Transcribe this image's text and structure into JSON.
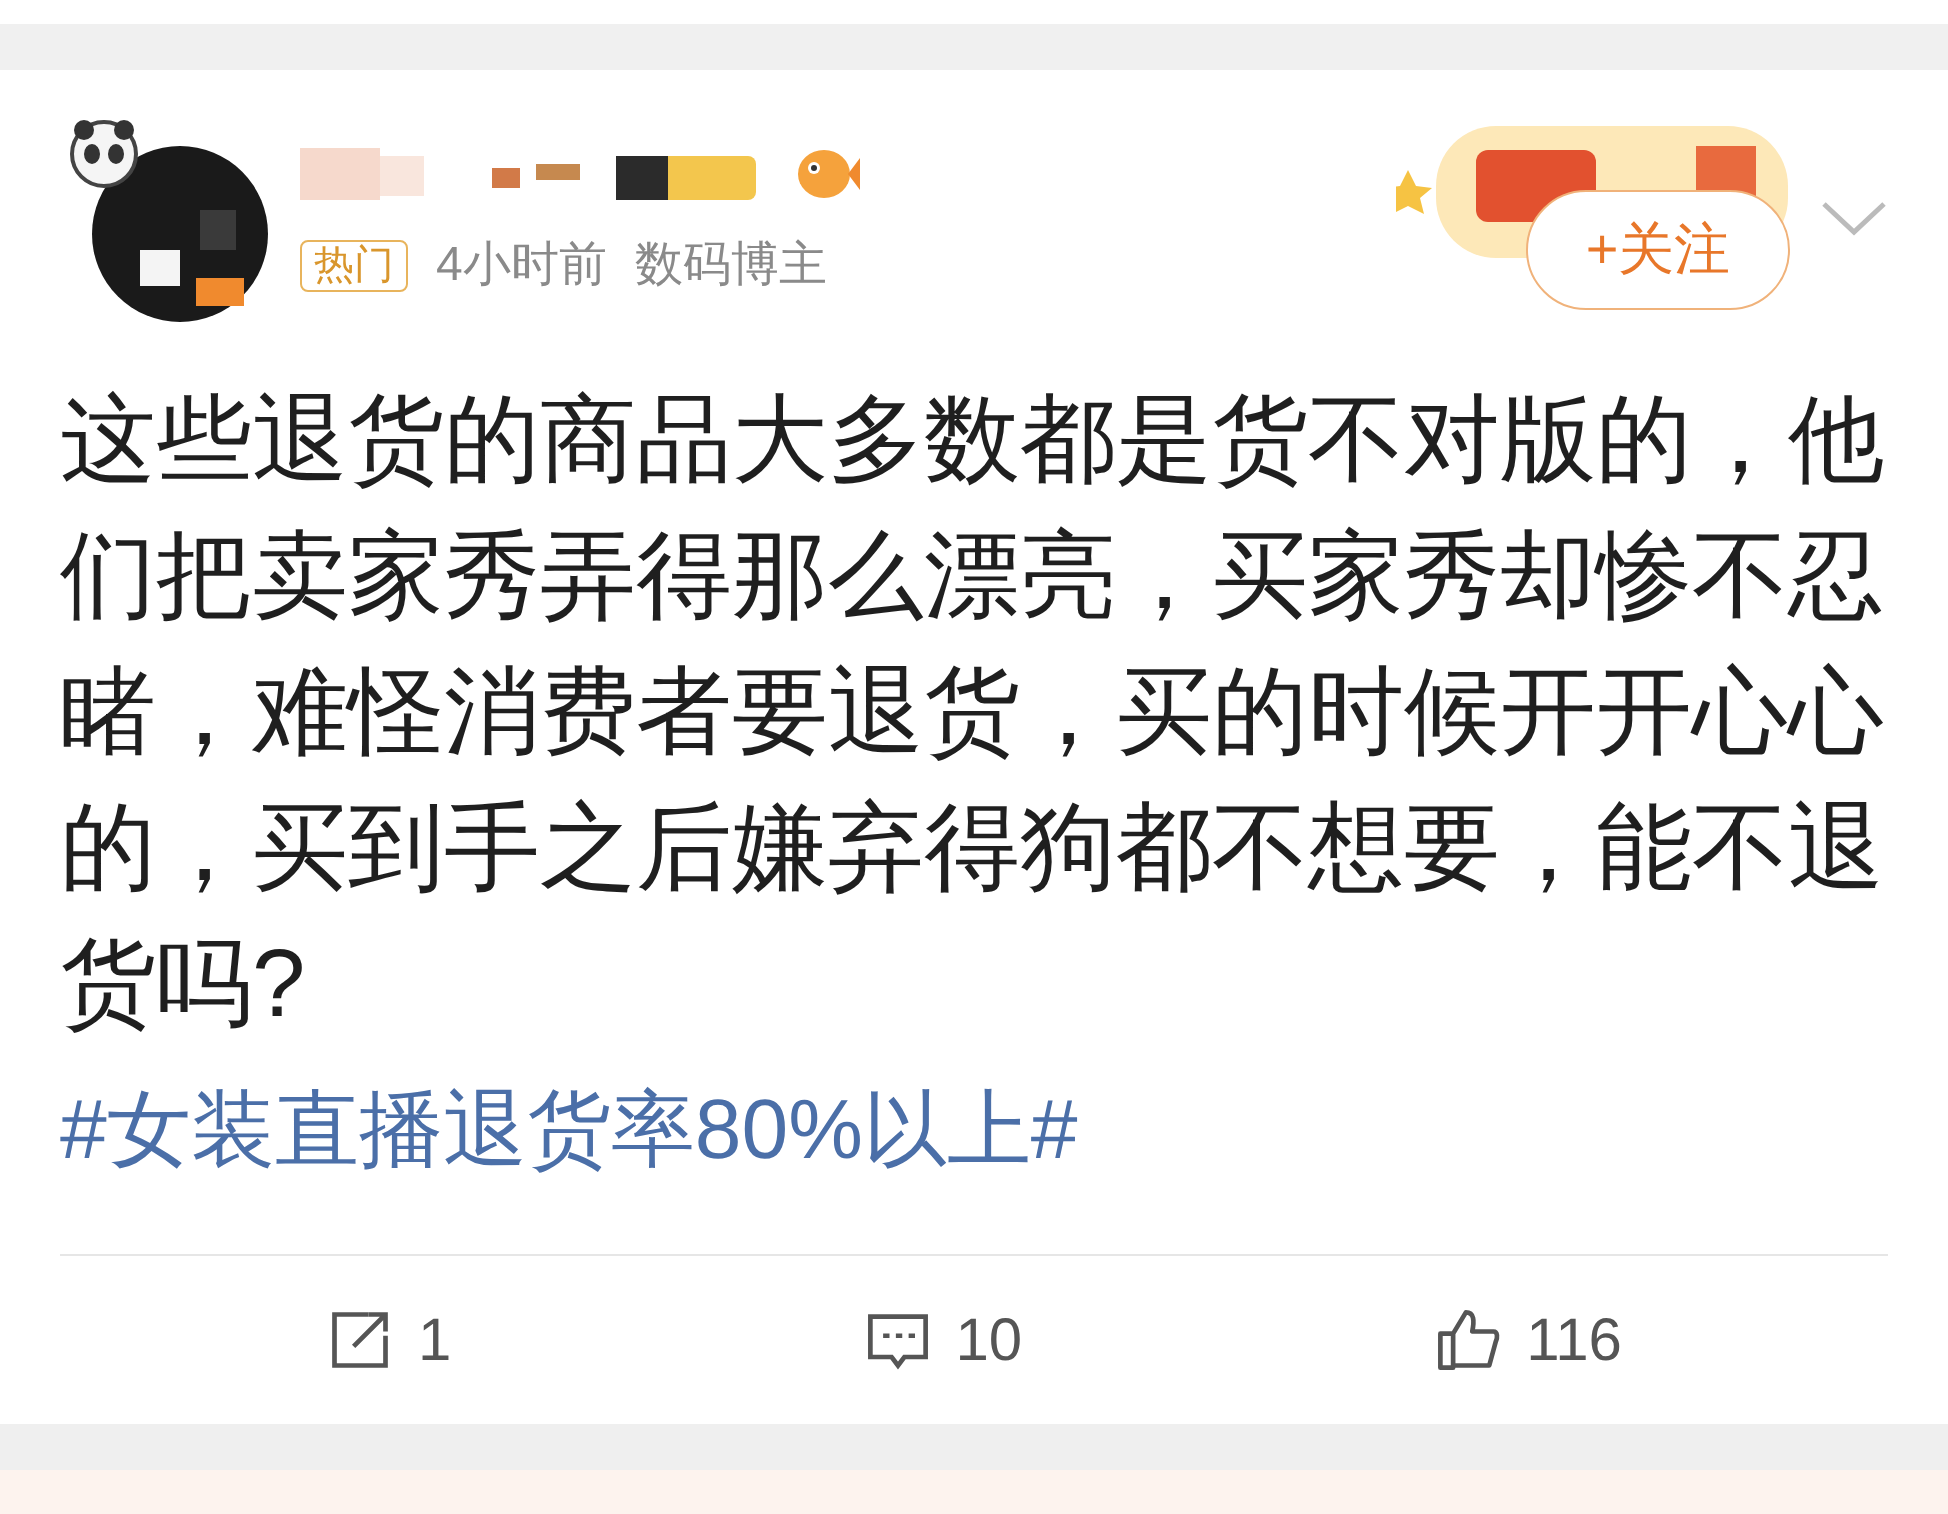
{
  "post": {
    "badge": "热门",
    "time": "4小时前",
    "author_tag": "数码博主",
    "follow_button": "+关注",
    "text": "这些退货的商品大多数都是货不对版的，他们把卖家秀弄得那么漂亮，买家秀却惨不忍睹，难怪消费者要退货，买的时候开开心心的，买到手之后嫌弃得狗都不想要，能不退货吗?",
    "hashtag": "#女装直播退货率80%以上#"
  },
  "actions": [
    {
      "kind": "share",
      "count": "1"
    },
    {
      "kind": "comment",
      "count": "10"
    },
    {
      "kind": "like",
      "count": "116"
    }
  ]
}
